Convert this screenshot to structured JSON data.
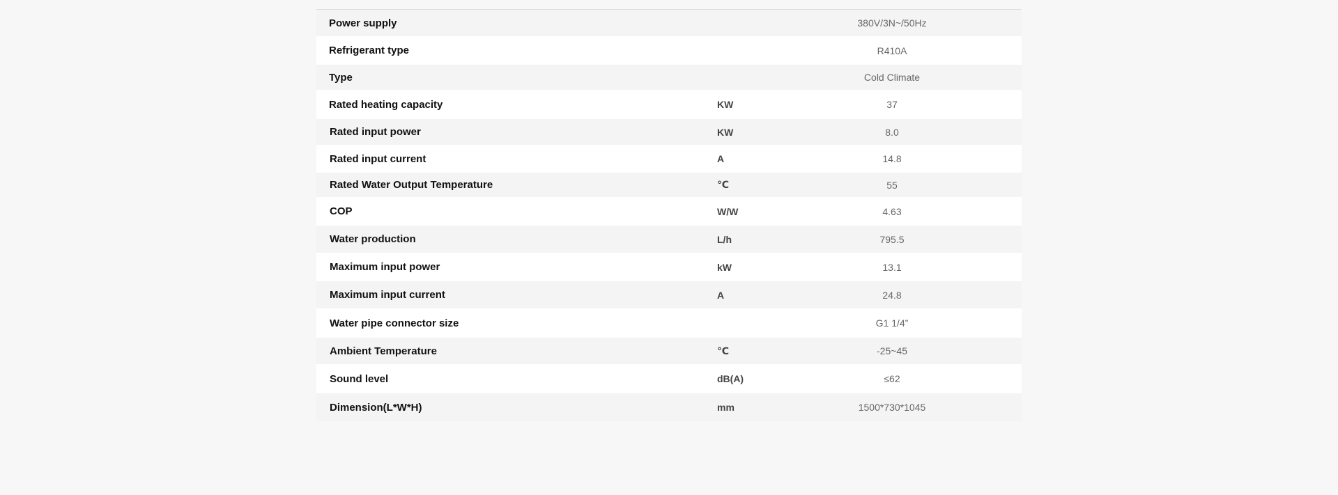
{
  "specs": {
    "rows": [
      {
        "name": "Power supply",
        "unit": "",
        "value": "380V/3N~/50Hz"
      },
      {
        "name": "Refrigerant type",
        "unit": "",
        "value": "R410A"
      },
      {
        "name": "Type",
        "unit": "",
        "value": "Cold Climate"
      },
      {
        "name": "Rated heating capacity",
        "unit": "KW",
        "value": "37"
      },
      {
        "name": "Rated input power",
        "unit": "KW",
        "value": "8.0"
      },
      {
        "name": "Rated input current",
        "unit": "A",
        "value": "14.8"
      },
      {
        "name": "Rated Water Output Temperature",
        "unit": "℃",
        "value": "55"
      },
      {
        "name": "COP",
        "unit": "W/W",
        "value": "4.63"
      },
      {
        "name": "Water production",
        "unit": "L/h",
        "value": "795.5"
      },
      {
        "name": "Maximum input power",
        "unit": "kW",
        "value": "13.1"
      },
      {
        "name": "Maximum input current",
        "unit": "A",
        "value": "24.8"
      },
      {
        "name": "Water pipe connector size",
        "unit": "",
        "value": "G1 1/4”"
      },
      {
        "name": "Ambient Temperature",
        "unit": "℃",
        "value": "-25~45"
      },
      {
        "name": "Sound level",
        "unit": "dB(A)",
        "value": "≤62"
      },
      {
        "name": "Dimension(L*W*H)",
        "unit": "mm",
        "value": "1500*730*1045"
      }
    ]
  }
}
